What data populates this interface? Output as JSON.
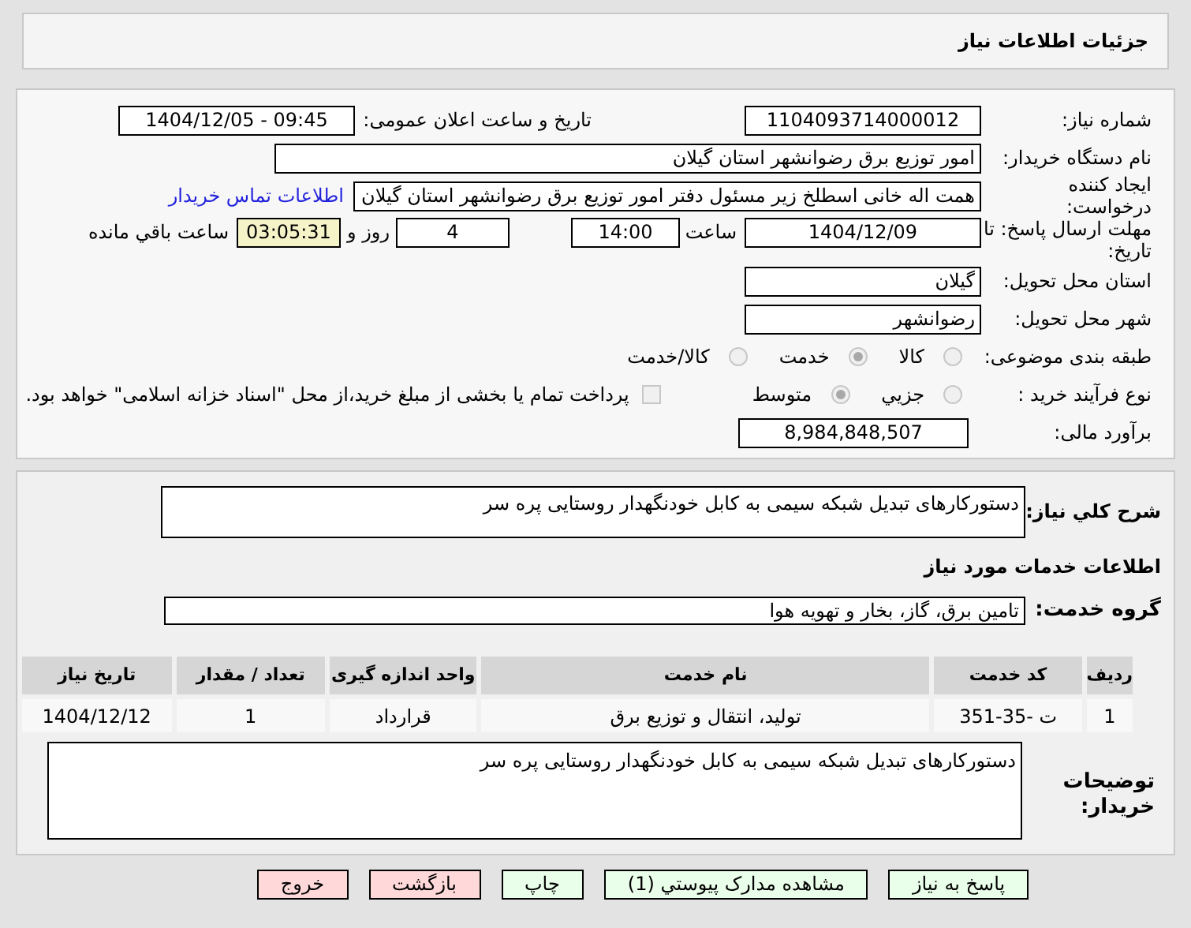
{
  "header": {
    "title": "جزئیات اطلاعات نیاز"
  },
  "need_number": {
    "label": "شماره نیاز:",
    "value": "1104093714000012"
  },
  "announce": {
    "label": "تاریخ و ساعت اعلان عمومی:",
    "value": "1404/12/05 - 09:45"
  },
  "buyer_org": {
    "label": "نام دستگاه خریدار:",
    "value": "امور توزیع برق رضوانشهر استان گیلان"
  },
  "requester": {
    "label": "ایجاد کننده درخواست:",
    "value": "همت اله خانی اسطلخ زیر مسئول دفتر امور توزیع برق رضوانشهر استان گیلان",
    "link": "اطلاعات تماس خریدار"
  },
  "deadline": {
    "label": "مهلت ارسال پاسخ: تا تاریخ:",
    "date": "1404/12/09",
    "time_label": "ساعت",
    "time": "14:00",
    "days": "4",
    "days_label": "روز و",
    "remaining": "03:05:31",
    "remaining_label": "ساعت باقي مانده"
  },
  "province": {
    "label": "استان محل تحویل:",
    "value": "گیلان"
  },
  "city": {
    "label": "شهر محل تحویل:",
    "value": "رضوانشهر"
  },
  "category": {
    "label": "طبقه بندی موضوعی:",
    "options": [
      {
        "label": "کالا",
        "selected": false
      },
      {
        "label": "خدمت",
        "selected": true
      },
      {
        "label": "کالا/خدمت",
        "selected": false
      }
    ]
  },
  "process": {
    "label": "نوع فرآیند خرید :",
    "options": [
      {
        "label": "جزیي",
        "selected": false
      },
      {
        "label": "متوسط",
        "selected": true
      }
    ],
    "checkbox": {
      "label": "پرداخت تمام یا بخشی از مبلغ خرید،از محل \"اسناد خزانه اسلامی\" خواهد بود.",
      "checked": false
    }
  },
  "budget": {
    "label": "برآورد مالی:",
    "value": "8,984,848,507"
  },
  "description": {
    "label": "شرح کلي نياز:",
    "value": "دستورکارهای تبدیل شبکه سیمی به کابل خودنگهدار روستایی پره سر"
  },
  "services_title": "اطلاعات خدمات مورد نياز",
  "service_group": {
    "label": "گروه خدمت:",
    "value": "تامین برق، گاز، بخار و تهویه هوا"
  },
  "table": {
    "columns": [
      "ردیف",
      "کد خدمت",
      "نام خدمت",
      "واحد اندازه گیری",
      "تعداد / مقدار",
      "تاریخ نیاز"
    ],
    "rows": [
      [
        "1",
        "ت -35-351",
        "تولید، انتقال و توزیع برق",
        "قرارداد",
        "1",
        "1404/12/12"
      ]
    ]
  },
  "buyer_notes": {
    "label": "توضیحات خریدار:",
    "value": "دستورکارهای تبدیل شبکه سیمی به کابل خودنگهدار روستایی پره سر"
  },
  "buttons": [
    {
      "label": "پاسخ به نیاز",
      "kind": "green"
    },
    {
      "label": "مشاهده مدارک پیوستي (1)",
      "kind": "green"
    },
    {
      "label": "چاپ",
      "kind": "green"
    },
    {
      "label": "بازگشت",
      "kind": "red"
    },
    {
      "label": "خروج",
      "kind": "red"
    }
  ]
}
